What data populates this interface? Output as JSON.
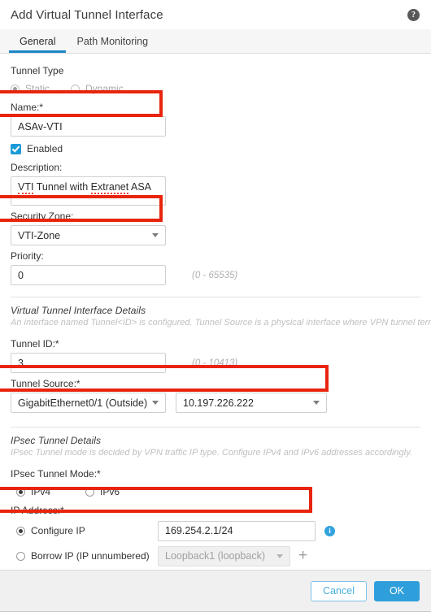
{
  "header": {
    "title": "Add Virtual Tunnel Interface",
    "help_icon": "help-circle-icon"
  },
  "tabs": [
    {
      "label": "General",
      "active": true
    },
    {
      "label": "Path Monitoring",
      "active": false
    }
  ],
  "general": {
    "tunnel_type": {
      "label": "Tunnel Type",
      "options": [
        {
          "label": "Static",
          "selected": true,
          "disabled": true
        },
        {
          "label": "Dynamic",
          "selected": false,
          "disabled": true
        }
      ]
    },
    "name": {
      "label": "Name:*",
      "value": "ASAv-VTI",
      "highlighted": true
    },
    "enabled": {
      "label": "Enabled",
      "checked": true
    },
    "description": {
      "label": "Description:",
      "value_part1": "VTI",
      "value_part2": " Tunnel with ",
      "value_part3": "Extranet",
      "value_part4": " ASA"
    },
    "security_zone": {
      "label": "Security Zone:",
      "value": "VTI-Zone",
      "highlighted": true
    },
    "priority": {
      "label": "Priority:",
      "value": "0",
      "range": "(0 - 65535)"
    }
  },
  "vti_details": {
    "section_title": "Virtual Tunnel Interface Details",
    "section_desc": "An interface named Tunnel<ID> is configured. Tunnel Source is a physical interface where VPN tunnel terminates for the VTI",
    "tunnel_id": {
      "label": "Tunnel ID:*",
      "value": "3",
      "range": "(0 - 10413)"
    },
    "tunnel_source": {
      "label": "Tunnel Source:*",
      "interface": "GigabitEthernet0/1 (Outside)",
      "address": "10.197.226.222",
      "highlighted": true
    }
  },
  "ipsec_details": {
    "section_title": "IPsec Tunnel Details",
    "section_desc": "IPsec Tunnel mode is decided by VPN traffic IP type. Configure IPv4 and IPv6 addresses accordingly.",
    "tunnel_mode": {
      "label": "IPsec Tunnel Mode:*",
      "options": [
        {
          "label": "IPv4",
          "selected": true
        },
        {
          "label": "IPv6",
          "selected": false
        }
      ]
    },
    "ip_address": {
      "label": "IP Address:*",
      "configure_ip": {
        "label": "Configure IP",
        "selected": true,
        "value": "169.254.2.1/24",
        "info_icon": "info-circle-icon",
        "highlighted": true
      },
      "borrow_ip": {
        "label": "Borrow IP (IP unnumbered)",
        "selected": false,
        "value": "Loopback1 (loopback)",
        "disabled": true,
        "add_icon": "plus-icon"
      }
    }
  },
  "footer": {
    "cancel_label": "Cancel",
    "ok_label": "OK"
  },
  "colors": {
    "accent_blue": "#2f9fdc",
    "tab_underline": "#1b87c9",
    "highlight_red": "#e8240d",
    "checkbox_blue": "#1b9bd8",
    "info_blue": "#32a3dd"
  }
}
